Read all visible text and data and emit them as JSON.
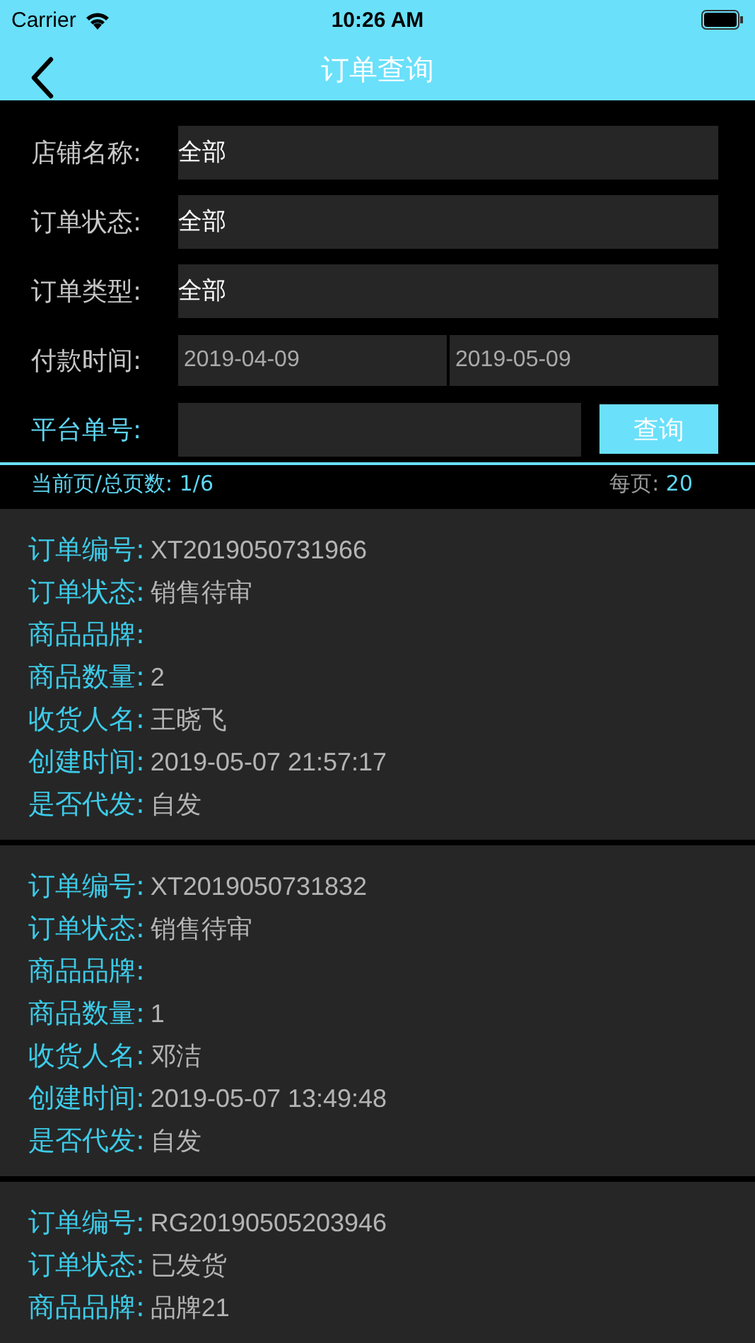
{
  "status_bar": {
    "carrier": "Carrier",
    "time": "10:26 AM"
  },
  "nav": {
    "title": "订单查询"
  },
  "filters": [
    {
      "kind": "select",
      "label": "店铺名称:",
      "value": "全部"
    },
    {
      "kind": "select",
      "label": "订单状态:",
      "value": "全部"
    },
    {
      "kind": "select",
      "label": "订单类型:",
      "value": "全部"
    },
    {
      "kind": "daterange",
      "label": "付款时间:",
      "from": "2019-04-09",
      "to": "2019-05-09"
    },
    {
      "kind": "search",
      "label": "平台单号:",
      "button": "查询"
    }
  ],
  "pagination": {
    "page_label": "当前页/总页数:",
    "page_value": "1/6",
    "size_label": "每页:",
    "size_value": "20"
  },
  "orders": [
    {
      "fields": [
        {
          "label": "订单编号:",
          "value": "XT2019050731966"
        },
        {
          "label": "订单状态:",
          "value": "销售待审"
        },
        {
          "label": "商品品牌:"
        },
        {
          "label": "商品数量:",
          "value": "2"
        },
        {
          "label": "收货人名:",
          "value": "王晓飞"
        },
        {
          "label": "创建时间:",
          "value": "2019-05-07 21:57:17"
        },
        {
          "label": "是否代发:",
          "value": "自发"
        }
      ]
    },
    {
      "fields": [
        {
          "label": "订单编号:",
          "value": "XT2019050731832"
        },
        {
          "label": "订单状态:",
          "value": "销售待审"
        },
        {
          "label": "商品品牌:"
        },
        {
          "label": "商品数量:",
          "value": "1"
        },
        {
          "label": "收货人名:",
          "value": "邓洁"
        },
        {
          "label": "创建时间:",
          "value": "2019-05-07 13:49:48"
        },
        {
          "label": "是否代发:",
          "value": "自发"
        }
      ]
    },
    {
      "fields": [
        {
          "label": "订单编号:",
          "value": "RG20190505203946"
        },
        {
          "label": "订单状态:",
          "value": "已发货"
        },
        {
          "label": "商品品牌:",
          "value": "品牌21"
        }
      ]
    }
  ]
}
